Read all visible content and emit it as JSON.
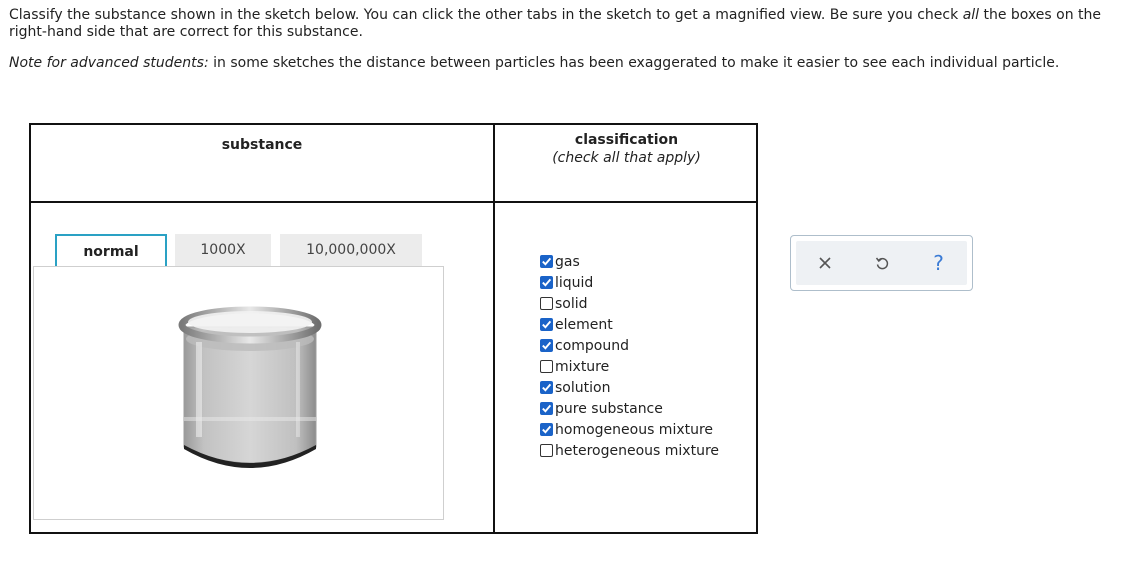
{
  "prompt": {
    "line1_before": "Classify the substance shown in the sketch below. You can click the other tabs in the sketch to get a magnified view. Be sure you check ",
    "line1_emph": "all",
    "line1_after": " the boxes on the right-hand side that are correct for this substance.",
    "note_label": "Note for advanced students:",
    "note_text": " in some sketches the distance between particles has been exaggerated to make it easier to see each individual particle."
  },
  "table": {
    "substance_header": "substance",
    "classification_header": "classification",
    "classification_sub": "(check all that apply)"
  },
  "tabs": [
    {
      "label": "normal",
      "selected": true
    },
    {
      "label": "1000X",
      "selected": false
    },
    {
      "label": "10,000,000X",
      "selected": false
    }
  ],
  "options": [
    {
      "label": "gas",
      "checked": true
    },
    {
      "label": "liquid",
      "checked": true
    },
    {
      "label": "solid",
      "checked": false
    },
    {
      "label": "element",
      "checked": true
    },
    {
      "label": "compound",
      "checked": true
    },
    {
      "label": "mixture",
      "checked": false
    },
    {
      "label": "solution",
      "checked": true
    },
    {
      "label": "pure substance",
      "checked": true
    },
    {
      "label": "homogeneous mixture",
      "checked": true
    },
    {
      "label": "heterogeneous mixture",
      "checked": false
    }
  ],
  "toolbar": {
    "clear_icon": "close-icon",
    "undo_icon": "undo-icon",
    "help_label": "?"
  },
  "colors": {
    "accent": "#2aa1c4",
    "checkbox_on": "#1a63c8",
    "help": "#3a7bd5"
  }
}
